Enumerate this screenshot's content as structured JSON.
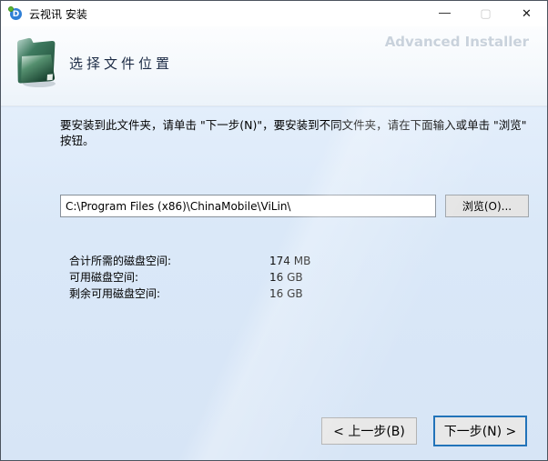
{
  "window": {
    "title": "云视讯 安装",
    "controls": {
      "minimize_glyph": "—",
      "maximize_glyph": "▢",
      "close_glyph": "✕"
    }
  },
  "header": {
    "page_title": "选择文件位置",
    "watermark": "Advanced Installer",
    "icon": "green-folder-icon"
  },
  "instructions": "要安装到此文件夹，请单击 \"下一步(N)\"，要安装到不同文件夹，请在下面输入或单击 \"浏览\" 按钮。",
  "path_input": {
    "value": "C:\\Program Files (x86)\\ChinaMobile\\ViLin\\"
  },
  "browse_button": {
    "label": "浏览(O)..."
  },
  "disk": {
    "rows": [
      {
        "label": "合计所需的磁盘空间:",
        "value": "174 MB"
      },
      {
        "label": "可用磁盘空间:",
        "value": "16 GB"
      },
      {
        "label": "剩余可用磁盘空间:",
        "value": "16 GB"
      }
    ]
  },
  "nav": {
    "back_label": "< 上一步(B)",
    "next_label": "下一步(N) >"
  },
  "colors": {
    "body_blue": "#d9e7f7",
    "accent_blue": "#2273b9",
    "header_white": "#fcfdfe",
    "folder_green": "#2e6b52"
  }
}
